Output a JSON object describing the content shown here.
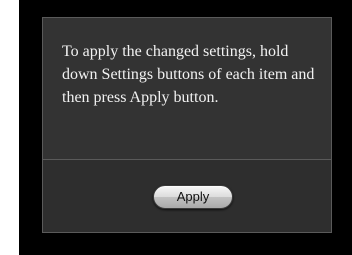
{
  "dialog": {
    "message": "To apply the changed settings, hold down Settings buttons of each item and then press Apply button.",
    "apply_label": "Apply"
  },
  "colors": {
    "background": "#000000",
    "dialog_background": "#333333",
    "text": "#f2f2f2"
  }
}
